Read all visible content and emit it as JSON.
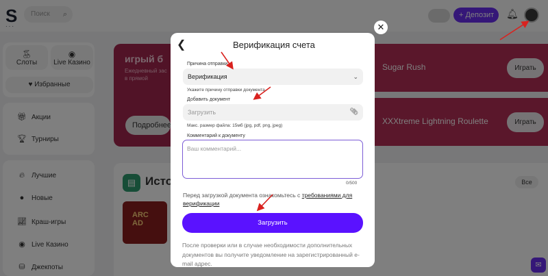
{
  "header": {
    "logo": "S",
    "logo_dots": "···",
    "search_placeholder": "Поиск",
    "deposit_label": "+ Депозит"
  },
  "sidebar": {
    "tiles": [
      {
        "label": "Слоты",
        "icon": "cherry-icon"
      },
      {
        "label": "Live Казино",
        "icon": "chip-icon"
      }
    ],
    "favorites": "Избранные",
    "promo_items": [
      {
        "label": "Акции",
        "icon": "gift-icon"
      },
      {
        "label": "Турниры",
        "icon": "trophy-icon"
      }
    ],
    "category_items": [
      {
        "label": "Лучшие",
        "icon": "fire-icon"
      },
      {
        "label": "Новые",
        "icon": "new-icon"
      },
      {
        "label": "Краш-игры",
        "icon": "chart-icon"
      },
      {
        "label": "Live Казино",
        "icon": "chip-icon"
      },
      {
        "label": "Джекпоты",
        "icon": "coins-icon"
      }
    ]
  },
  "banner": {
    "title": "игрый б",
    "subtitle": "Ежедневный зас\nв прямой",
    "more_label": "Подробнее"
  },
  "games": [
    {
      "name": "Sugar Rush",
      "play_label": "Играть"
    },
    {
      "name": "XXXtreme Lightning Roulette",
      "play_label": "Играть"
    }
  ],
  "history": {
    "title": "Исто",
    "all_label": "Все",
    "thumb_text": "ARC\nAD"
  },
  "modal": {
    "title": "Верификация счета",
    "reason_label": "Причина отправки",
    "reason_value": "Верификация",
    "reason_hint": "Укажите причину отправки документа",
    "doc_label": "Добавить документ",
    "doc_placeholder": "Загрузить",
    "doc_hint": "Макс. размер файла: 15мб (jpg, pdf, png, jpeg)",
    "comment_label": "Комментарий к документу",
    "comment_placeholder": "Ваш комментарий...",
    "counter": "0/500",
    "notice_prefix": "Перед загрузкой документа ознакомьтесь с",
    "notice_link": "требованиями для верификации",
    "upload_label": "Загрузить",
    "after_text": "После проверки или в случае необходимости дополнительных документов вы получите уведомление на зарегистрированный e-mail адрес."
  },
  "colors": {
    "accent": "#5a12ff",
    "annotation_arrow": "#d9221f"
  }
}
